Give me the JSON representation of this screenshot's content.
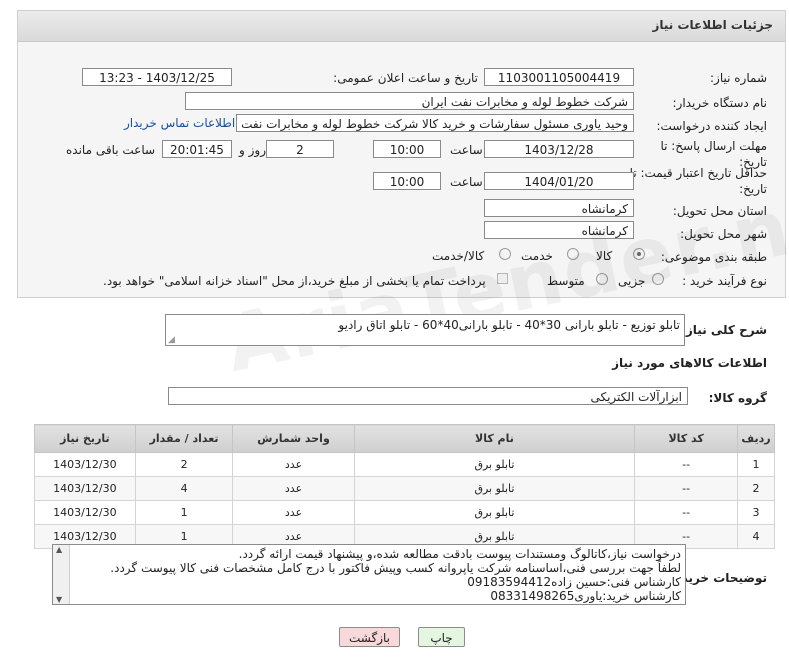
{
  "panel_title": "جزئیات اطلاعات نیاز",
  "fields": {
    "need_number_label": "شماره نیاز:",
    "need_number": "1103001105004419",
    "announce_datetime_label": "تاریخ و ساعت اعلان عمومی:",
    "announce_datetime": "1403/12/25 - 13:23",
    "buyer_org_label": "نام دستگاه خریدار:",
    "buyer_org": "شرکت خطوط لوله و مخابرات نفت ایران",
    "requester_label": "ایجاد کننده درخواست:",
    "requester": "وحید یاوری مسئول سفارشات و خرید کالا  شرکت خطوط لوله و مخابرات نفت ایرا",
    "buyer_contact_link": "اطلاعات تماس خریدار",
    "reply_deadline_label": "مهلت ارسال پاسخ: تا تاریخ:",
    "reply_date": "1403/12/28",
    "time_label": "ساعت",
    "reply_time": "10:00",
    "days_count": "2",
    "days_label": "روز و",
    "remaining_time": "20:01:45",
    "remaining_label": "ساعت باقی مانده",
    "price_validity_label": "حداقل تاریخ اعتبار قیمت: تا تاریخ:",
    "price_validity_date": "1404/01/20",
    "price_validity_time": "10:00",
    "province_label": "استان محل تحویل:",
    "province": "کرمانشاه",
    "city_label": "شهر محل تحویل:",
    "city": "کرمانشاه",
    "category_label": "طبقه بندی موضوعی:",
    "category_options": [
      "کالا",
      "خدمت",
      "کالا/خدمت"
    ],
    "process_label": "نوع فرآیند خرید :",
    "process_options": [
      "جزیی",
      "متوسط"
    ],
    "payment_note": "پرداخت تمام یا بخشی از مبلغ خرید،از محل \"اسناد خزانه اسلامی\" خواهد بود."
  },
  "description": {
    "label": "شرح کلی نیاز:",
    "value": "تابلو توزیع - تابلو بارانی 30*40 - تابلو بارانی40*60 - تابلو اتاق رادیو"
  },
  "goods_section_title": "اطلاعات کالاهای مورد نیاز",
  "goods_group": {
    "label": "گروه کالا:",
    "value": "ابزارآلات الکتریکی"
  },
  "table": {
    "headers": [
      "ردیف",
      "کد کالا",
      "نام کالا",
      "واحد شمارش",
      "تعداد / مقدار",
      "تاریخ نیاز"
    ],
    "rows": [
      [
        "1",
        "--",
        "تابلو برق",
        "عدد",
        "2",
        "1403/12/30"
      ],
      [
        "2",
        "--",
        "تابلو برق",
        "عدد",
        "4",
        "1403/12/30"
      ],
      [
        "3",
        "--",
        "تابلو برق",
        "عدد",
        "1",
        "1403/12/30"
      ],
      [
        "4",
        "--",
        "تابلو برق",
        "عدد",
        "1",
        "1403/12/30"
      ]
    ]
  },
  "buyer_notes": {
    "label": "توضیحات خریدار:",
    "lines": [
      "درخواست نیاز،کاتالوگ ومستندات پیوست بادقت مطالعه شده،و پیشنهاد قیمت ارائه گردد.",
      "لطفاً جهت بررسی فنی،اساسنامه شرکت یاپروانه کسب وپیش فاکتور با درج کامل مشخصات فنی کالا پیوست گردد.",
      "کارشناس فنی:حسین زاده09183594412",
      "کارشناس خرید:یاوری08331498265"
    ]
  },
  "buttons": {
    "print": "چاپ",
    "back": "بازگشت"
  },
  "colors": {
    "link": "#1a4fa0",
    "back_button_bg": "#f7d9d9",
    "print_button_bg": "#e4f5e0"
  }
}
